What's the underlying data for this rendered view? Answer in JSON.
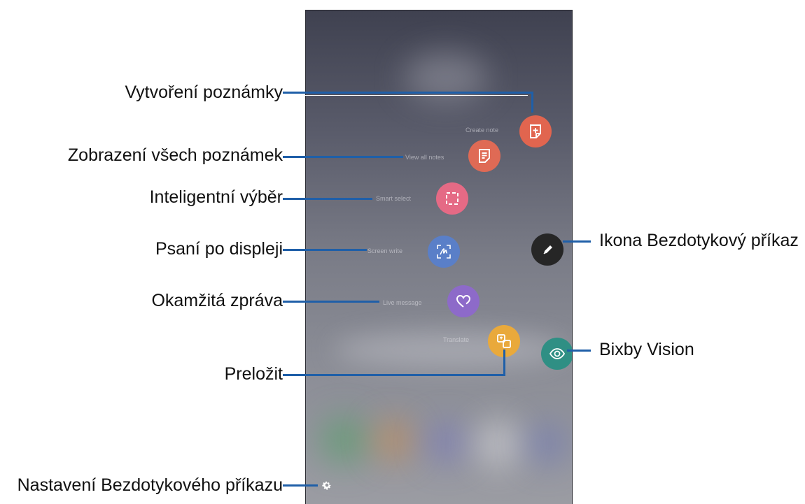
{
  "callouts": {
    "create_note": "Vytvoření poznámky",
    "view_all_notes": "Zobrazení všech poznámek",
    "smart_select": "Inteligentní výběr",
    "screen_write": "Psaní po displeji",
    "live_message": "Okamžitá zpráva",
    "translate": "Preložit",
    "settings": "Nastavení Bezdotykového příkazu",
    "air_command_icon": "Ikona Bezdotykový příkaz",
    "bixby_vision": "Bixby Vision"
  },
  "menu": {
    "create_note": "Create note",
    "view_all_notes": "View all notes",
    "smart_select": "Smart select",
    "screen_write": "Screen write",
    "live_message": "Live message",
    "translate": "Translate"
  },
  "icons": {
    "create_note": "note-plus-icon",
    "view_all_notes": "notes-list-icon",
    "smart_select": "dashed-frame-icon",
    "screen_write": "handwriting-icon",
    "live_message": "heart-icon",
    "translate": "translate-icon",
    "air_command": "pen-icon",
    "bixby_vision": "eye-icon",
    "settings": "gear-icon"
  },
  "colors": {
    "create_note": "#e1654f",
    "view_all_notes": "#df6a55",
    "smart_select": "#e56a85",
    "screen_write": "#5a7fc8",
    "live_message": "#8d6ac9",
    "translate": "#e9a93b",
    "air_command": "#262626",
    "bixby_vision": "#2f8f84",
    "callout_line": "#1f5fa8"
  }
}
